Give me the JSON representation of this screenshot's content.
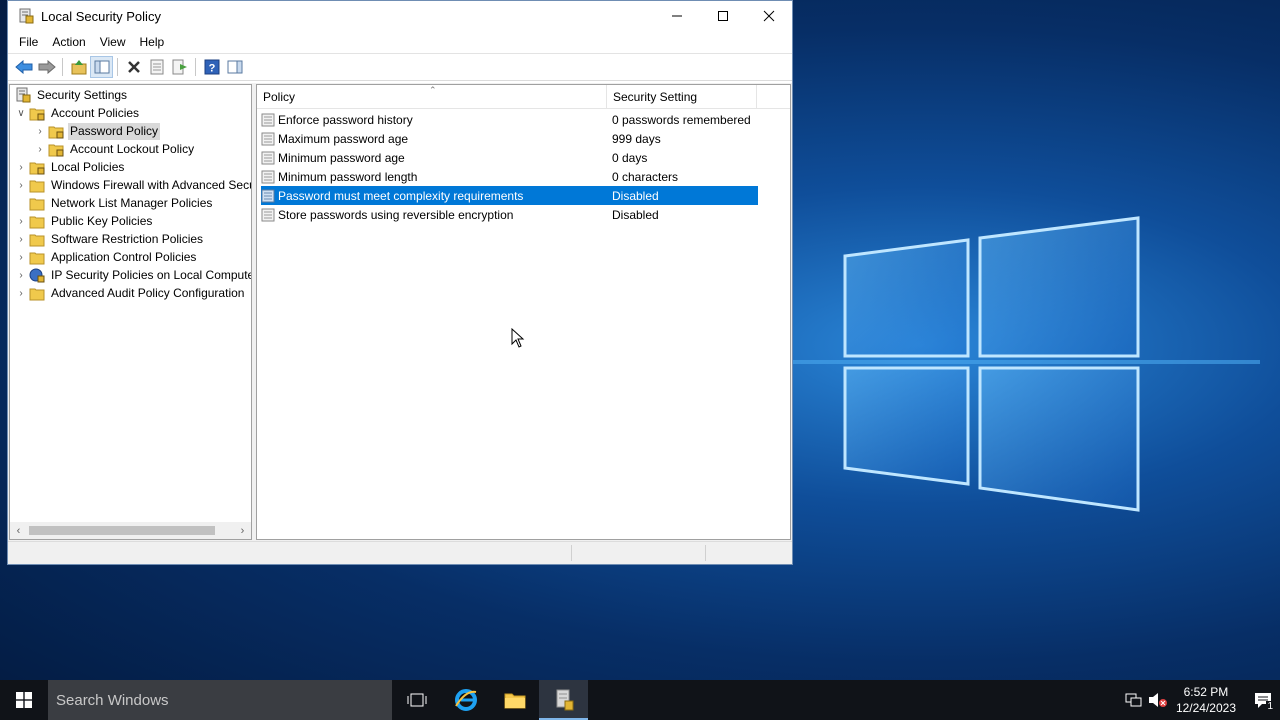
{
  "window": {
    "title": "Local Security Policy"
  },
  "menu": [
    "File",
    "Action",
    "View",
    "Help"
  ],
  "toolbar": {
    "icons": [
      "back-arrow-icon",
      "forward-arrow-icon",
      "up-folder-icon",
      "show-hide-tree-icon",
      "delete-icon",
      "properties-icon",
      "export-list-icon",
      "help-icon",
      "show-hide-action-pane-icon"
    ]
  },
  "tree": {
    "root": "Security Settings",
    "items": [
      {
        "label": "Account Policies",
        "expanded": true
      },
      {
        "label": "Password Policy",
        "selected": true
      },
      {
        "label": "Account Lockout Policy"
      },
      {
        "label": "Local Policies"
      },
      {
        "label": "Windows Firewall with Advanced Secu"
      },
      {
        "label": "Network List Manager Policies"
      },
      {
        "label": "Public Key Policies"
      },
      {
        "label": "Software Restriction Policies"
      },
      {
        "label": "Application Control Policies"
      },
      {
        "label": "IP Security Policies on Local Compute"
      },
      {
        "label": "Advanced Audit Policy Configuration"
      }
    ]
  },
  "list": {
    "columns": [
      "Policy",
      "Security Setting"
    ],
    "rows": [
      {
        "policy": "Enforce password history",
        "setting": "0 passwords remembered"
      },
      {
        "policy": "Maximum password age",
        "setting": "999 days"
      },
      {
        "policy": "Minimum password age",
        "setting": "0 days"
      },
      {
        "policy": "Minimum password length",
        "setting": "0 characters"
      },
      {
        "policy": "Password must meet complexity requirements",
        "setting": "Disabled",
        "selected": true
      },
      {
        "policy": "Store passwords using reversible encryption",
        "setting": "Disabled"
      }
    ]
  },
  "taskbar": {
    "search_placeholder": "Search Windows",
    "time": "6:52 PM",
    "date": "12/24/2023",
    "notification_count": "1"
  },
  "colors": {
    "selection": "#0078d7",
    "taskbar": "#101318"
  }
}
